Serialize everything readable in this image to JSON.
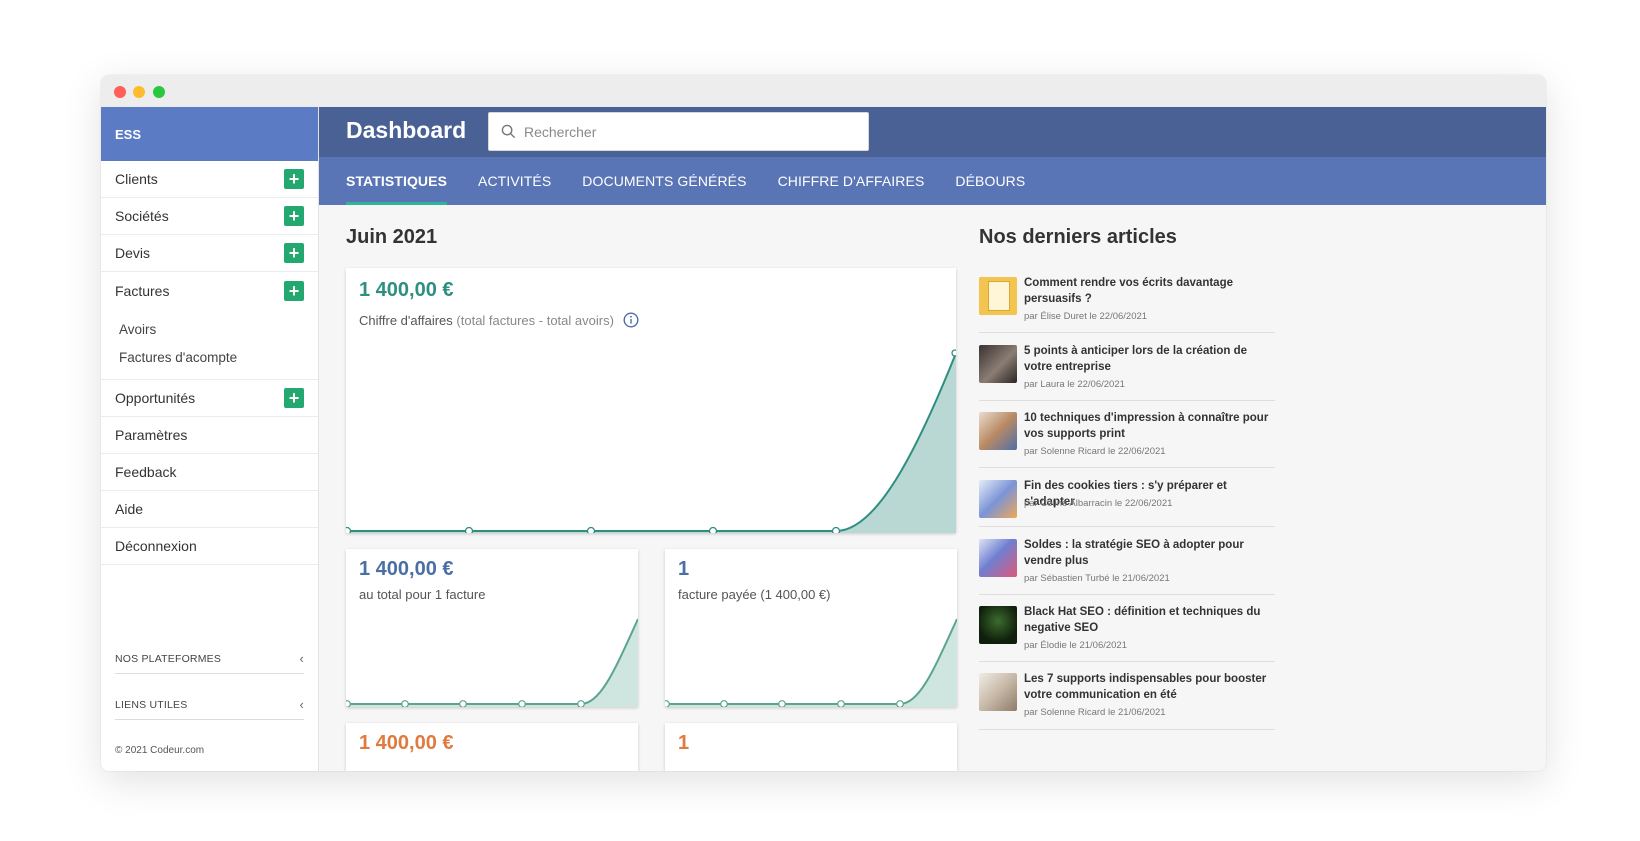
{
  "sidebar": {
    "brand": "ESS",
    "items": [
      {
        "label": "Clients"
      },
      {
        "label": "Sociétés"
      },
      {
        "label": "Devis"
      },
      {
        "label": "Factures"
      }
    ],
    "factures_sub": [
      {
        "label": "Avoirs"
      },
      {
        "label": "Factures d'acompte"
      }
    ],
    "items2": [
      {
        "label": "Opportunités"
      },
      {
        "label": "Paramètres"
      },
      {
        "label": "Feedback"
      },
      {
        "label": "Aide"
      },
      {
        "label": "Déconnexion"
      }
    ],
    "sections": [
      {
        "label": "NOS PLATEFORMES"
      },
      {
        "label": "LIENS UTILES"
      }
    ],
    "copyright": "© 2021 Codeur.com"
  },
  "header": {
    "title": "Dashboard",
    "search_placeholder": "Rechercher"
  },
  "tabs": [
    {
      "label": "STATISTIQUES",
      "active": true
    },
    {
      "label": "ACTIVITÉS"
    },
    {
      "label": "DOCUMENTS GÉNÉRÉS"
    },
    {
      "label": "CHIFFRE D'AFFAIRES"
    },
    {
      "label": "DÉBOURS"
    }
  ],
  "stats": {
    "month": "Juin 2021",
    "main_card": {
      "amount": "1 400,00 €",
      "label": "Chiffre d'affaires",
      "label_muted": "(total factures - total avoirs)"
    },
    "card_total": {
      "amount": "1 400,00 €",
      "label": "au total pour 1 facture"
    },
    "card_paid": {
      "amount": "1",
      "label": "facture payée (1 400,00 €)"
    },
    "card_bottom_left_amount": "1 400,00 €",
    "card_bottom_right_amount": "1"
  },
  "articles": {
    "title": "Nos derniers articles",
    "items": [
      {
        "title": "Comment rendre vos écrits davantage persuasifs  ?",
        "meta": "par Élise Duret le 22/06/2021"
      },
      {
        "title": "5 points à anticiper lors de la création de votre entreprise",
        "meta": "par Laura le 22/06/2021"
      },
      {
        "title": "10 techniques d'impression à connaître pour vos supports print",
        "meta": "par Solenne Ricard le 22/06/2021"
      },
      {
        "title": "Fin des cookies tiers : s'y préparer et s'adapter",
        "meta": "par Céline Albarracin le 22/06/2021"
      },
      {
        "title": "Soldes : la stratégie SEO à adopter pour vendre plus",
        "meta": "par Sébastien Turbé le 21/06/2021"
      },
      {
        "title": "Black Hat SEO  : définition et techniques du negative SEO",
        "meta": "par Élodie le 21/06/2021"
      },
      {
        "title": "Les 7 supports indispensables pour booster votre communication en été",
        "meta": "par Solenne Ricard le 21/06/2021"
      }
    ]
  },
  "colors": {
    "header_bg": "#4a6195",
    "tabs_bg": "#5a75b6",
    "brand_bg": "#5b7bc5",
    "accent_green": "#23a86f",
    "teal_amount": "#2e8f80",
    "blue_amount": "#4a6fa5",
    "orange_amount": "#e07a3f",
    "chart_line": "#2e8f80",
    "chart_fill": "#b9d8d3"
  },
  "icons": {
    "search": "search-icon",
    "add": "plus-icon",
    "info": "info-icon",
    "collapse": "chevron-left-icon"
  }
}
